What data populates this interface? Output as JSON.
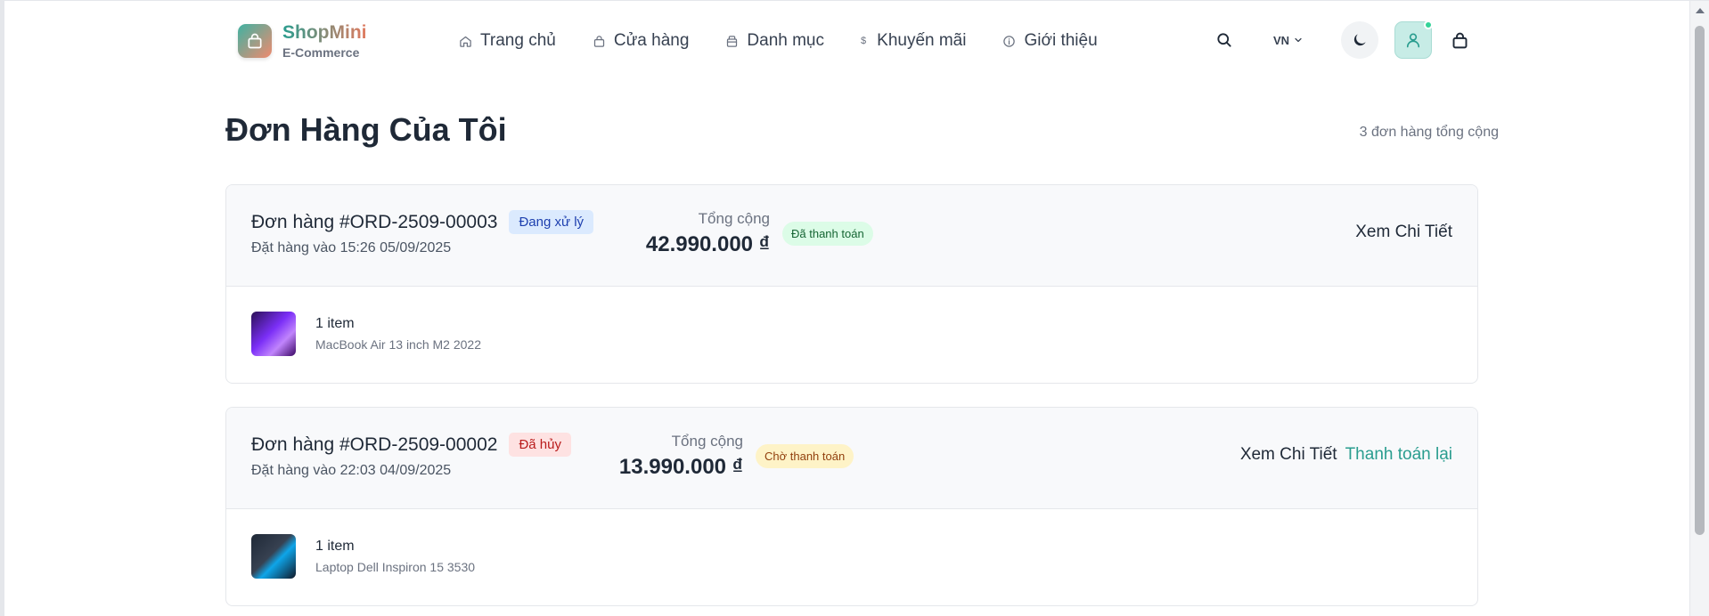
{
  "brand": {
    "name": "ShopMini",
    "tagline": "E-Commerce"
  },
  "nav": {
    "items": [
      {
        "label": "Trang chủ",
        "icon": "home-icon"
      },
      {
        "label": "Cửa hàng",
        "icon": "bag-icon"
      },
      {
        "label": "Danh mục",
        "icon": "box-icon"
      },
      {
        "label": "Khuyến mãi",
        "icon": "dollar-icon"
      },
      {
        "label": "Giới thiệu",
        "icon": "info-icon"
      }
    ]
  },
  "header": {
    "language": "VN"
  },
  "page": {
    "title": "Đơn Hàng Của Tôi",
    "order_count": "3 đơn hàng tổng cộng"
  },
  "orders": [
    {
      "id": "Đơn hàng #ORD-2509-00003",
      "status": "Đang xử lý",
      "date": "Đặt hàng vào 15:26 05/09/2025",
      "total_label": "Tổng cộng",
      "total": "42.990.000 ₫",
      "payment": "Đã thanh toán",
      "detail_label": "Xem Chi Tiết",
      "item_count": "1 item",
      "item_name": "MacBook Air 13 inch M2 2022"
    },
    {
      "id": "Đơn hàng #ORD-2509-00002",
      "status": "Đã hủy",
      "date": "Đặt hàng vào 22:03 04/09/2025",
      "total_label": "Tổng cộng",
      "total": "13.990.000 ₫",
      "payment": "Chờ thanh toán",
      "detail_label": "Xem Chi Tiết",
      "repay_label": "Thanh toán lại",
      "item_count": "1 item",
      "item_name": "Laptop Dell Inspiron 15 3530"
    }
  ],
  "colors": {
    "accent": "#2a9d8f",
    "brand_gradient_end": "#e07a5f"
  }
}
